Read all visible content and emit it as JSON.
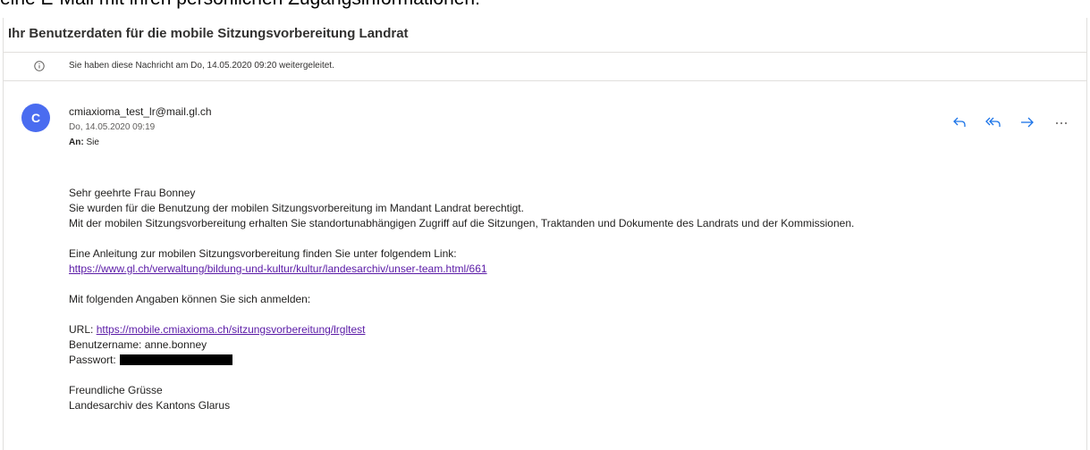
{
  "caption": "eine E-Mail mit ihren persönlichen Zugangsinformationen:",
  "email": {
    "subject": "Ihr Benutzerdaten für die mobile Sitzungsvorbereitung Landrat",
    "forward_notice": "Sie haben diese Nachricht am Do, 14.05.2020 09:20 weitergeleitet.",
    "avatar_letter": "C",
    "avatar_color": "#4a6cf0",
    "sender": "cmiaxioma_test_lr@mail.gl.ch",
    "date": "Do, 14.05.2020 09:19",
    "to_label": "An:",
    "to_value": "Sie",
    "actions": [
      "reply-icon",
      "reply-all-icon",
      "forward-icon",
      "more-icon"
    ],
    "body": {
      "greeting": "Sehr geehrte Frau Bonney",
      "line1": "Sie wurden für die Benutzung der mobilen Sitzungsvorbereitung im Mandant Landrat berechtigt.",
      "line2": "Mit der mobilen Sitzungsvorbereitung erhalten Sie standortunabhängigen Zugriff auf die Sitzungen, Traktanden und Dokumente des Landrats und der Kommissionen.",
      "guide_intro": "Eine Anleitung zur mobilen Sitzungsvorbereitung finden Sie unter folgendem Link:",
      "guide_link": "https://www.gl.ch/verwaltung/bildung-und-kultur/kultur/landesarchiv/unser-team.html/661",
      "login_intro": "Mit folgenden Angaben können Sie sich anmelden:",
      "url_label": "URL:",
      "url_link": "https://mobile.cmiaxioma.ch/sitzungsvorbereitung/lrgltest",
      "username": "Benutzername: anne.bonney",
      "password_label": "Passwort:",
      "closing": "Freundliche Grüsse",
      "signature": "Landesarchiv des Kantons Glarus"
    }
  },
  "colors": {
    "link": "#5a1aa6",
    "action_icons": "#1a73e8"
  }
}
